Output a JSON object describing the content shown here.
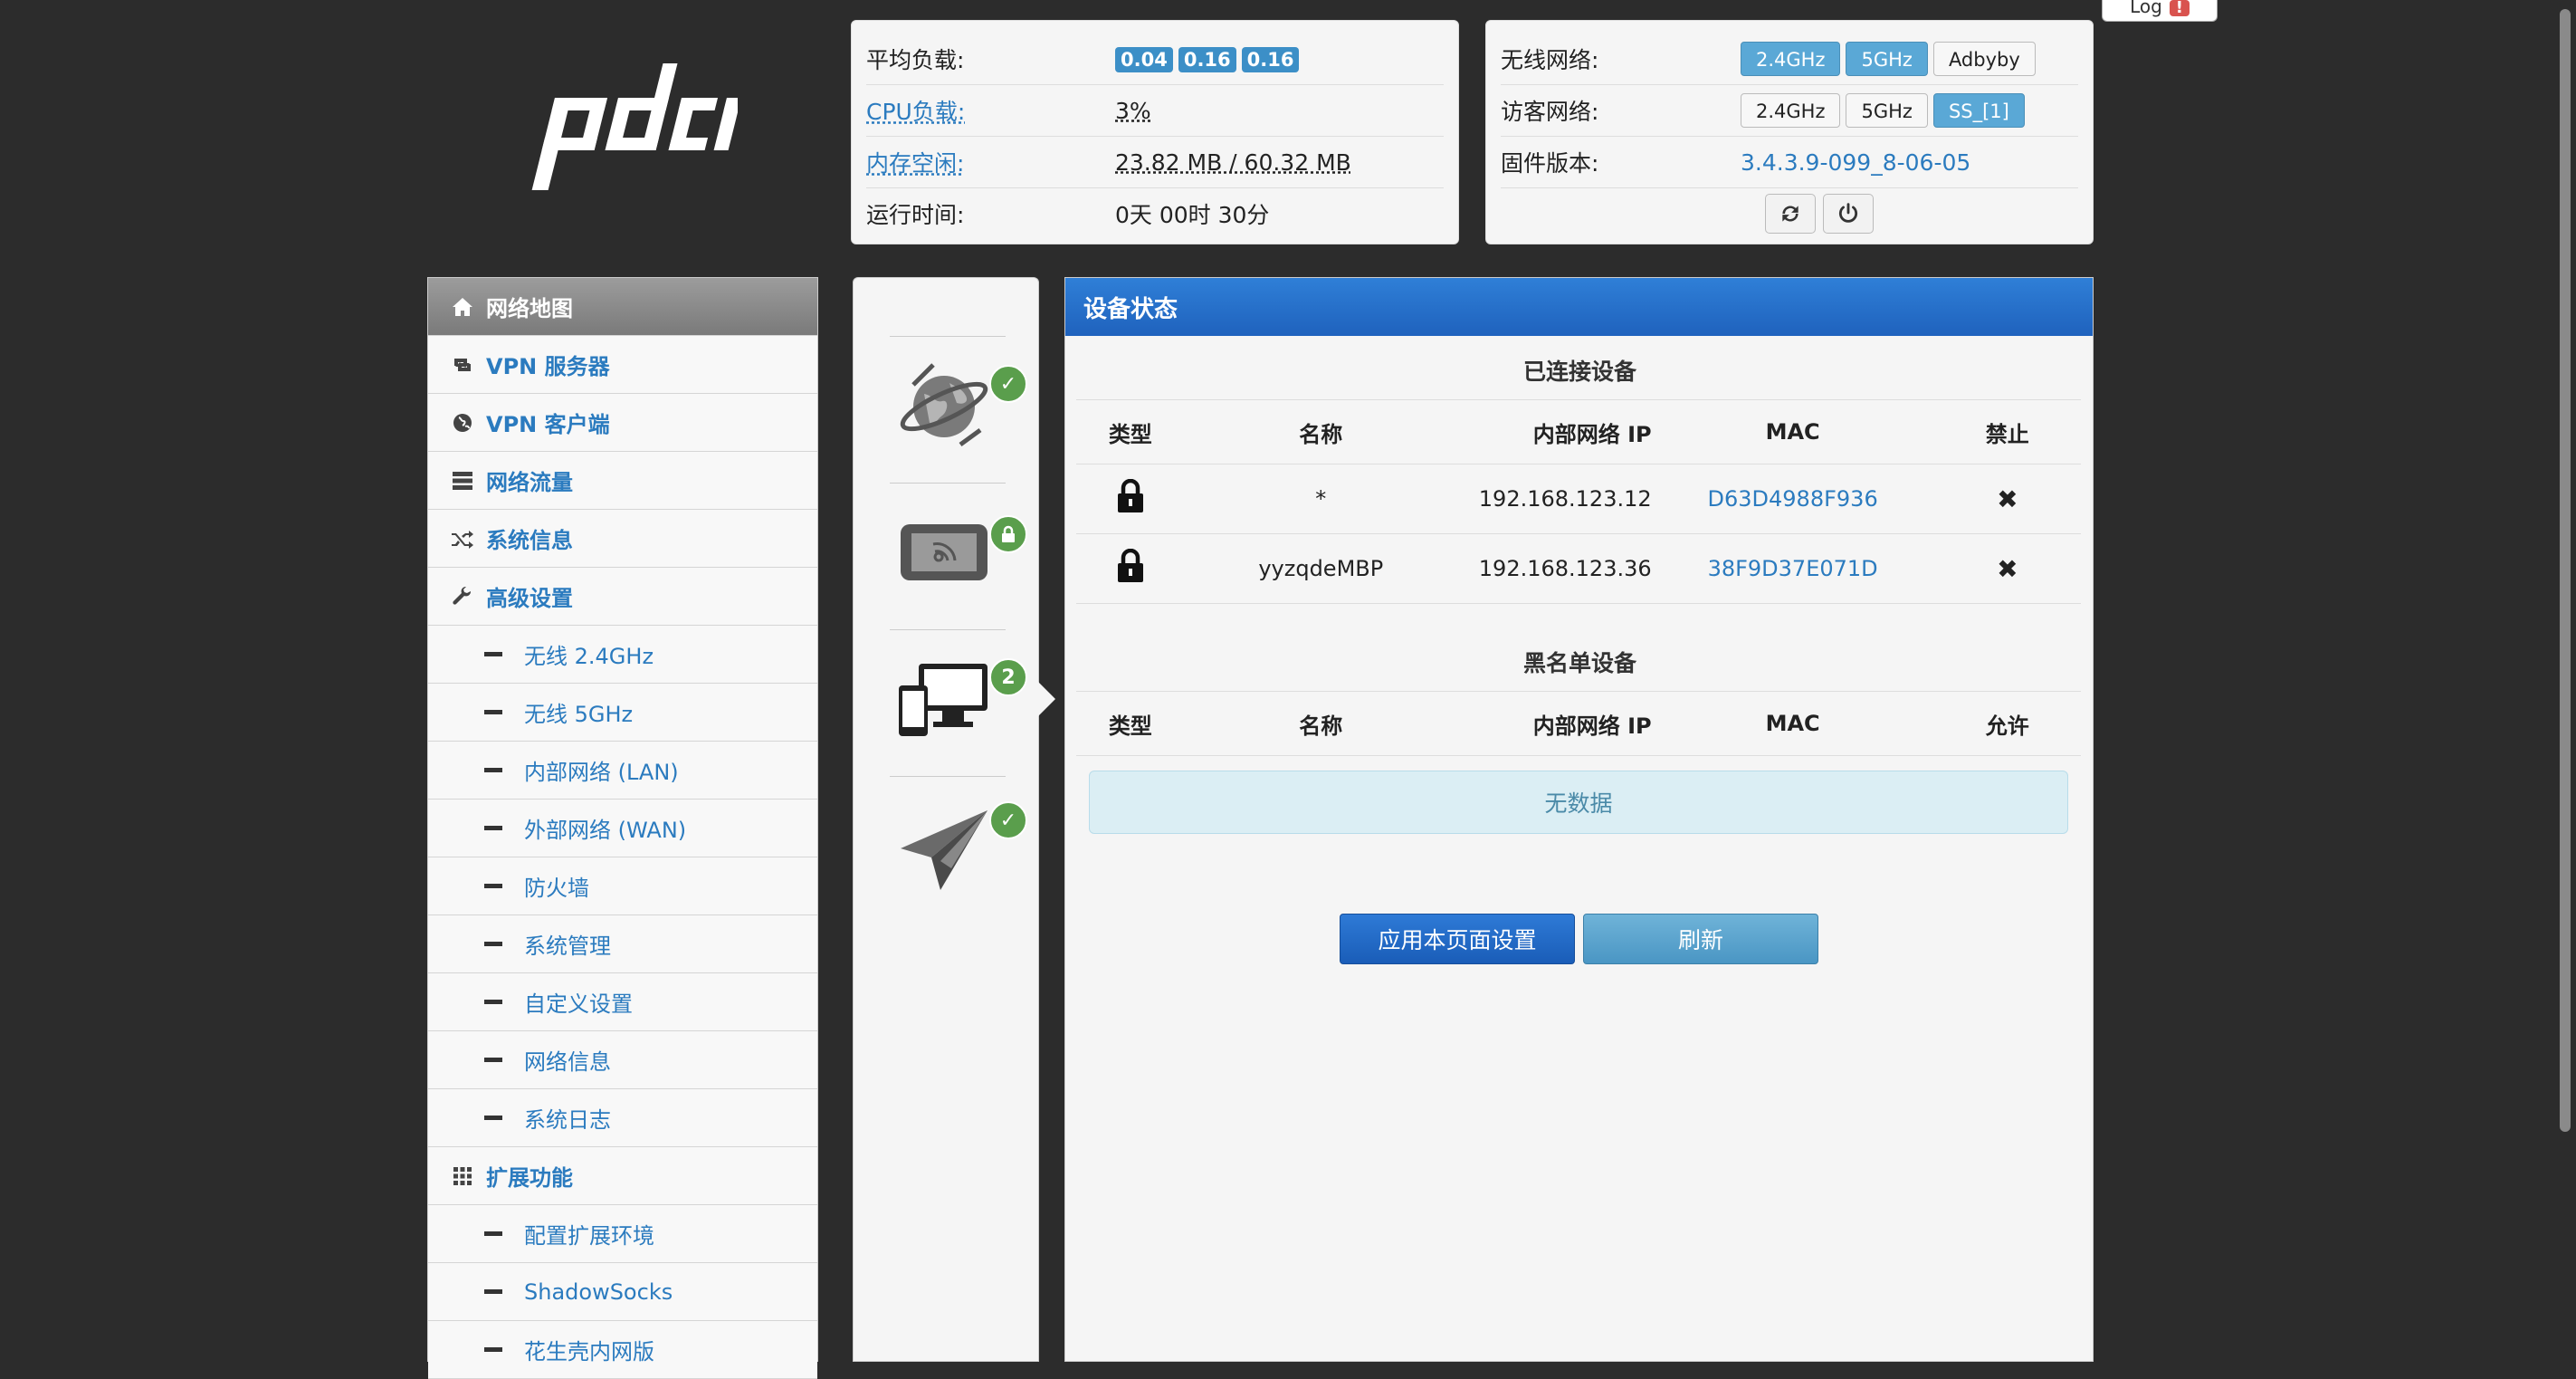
{
  "logo": {
    "text": "pdcn"
  },
  "log_tab": {
    "label": "Log",
    "badge": "!"
  },
  "system": {
    "avg_load_label": "平均负载:",
    "loads": [
      "0.04",
      "0.16",
      "0.16"
    ],
    "cpu_label": "CPU负载:",
    "cpu_value": "3%",
    "mem_label": "内存空闲:",
    "mem_value": "23.82 MB / 60.32 MB",
    "uptime_label": "运行时间:",
    "uptime_value": "0天 00时 30分"
  },
  "network": {
    "wireless_label": "无线网络:",
    "wireless_buttons": [
      "2.4GHz",
      "5GHz",
      "Adbyby"
    ],
    "guest_label": "访客网络:",
    "guest_buttons": [
      "2.4GHz",
      "5GHz",
      "SS_[1]"
    ],
    "firmware_label": "固件版本:",
    "firmware_value": "3.4.3.9-099_8-06-05"
  },
  "sidebar": {
    "items": [
      {
        "label": "网络地图",
        "icon": "home-icon"
      },
      {
        "label": "VPN 服务器",
        "icon": "retweet-icon"
      },
      {
        "label": "VPN 客户端",
        "icon": "globe-icon"
      },
      {
        "label": "网络流量",
        "icon": "server-icon"
      },
      {
        "label": "系统信息",
        "icon": "random-icon"
      },
      {
        "label": "高级设置",
        "icon": "wrench-icon"
      }
    ],
    "advanced_sub": [
      "无线 2.4GHz",
      "无线 5GHz",
      "内部网络 (LAN)",
      "外部网络 (WAN)",
      "防火墙",
      "系统管理",
      "自定义设置",
      "网络信息",
      "系统日志"
    ],
    "ext_label": "扩展功能",
    "ext_sub": [
      "配置扩展环境",
      "ShadowSocks",
      "花生壳内网版"
    ]
  },
  "status_icons": {
    "clients_count": "2"
  },
  "main": {
    "title": "设备状态",
    "connected_title": "已连接设备",
    "connected_headers": [
      "类型",
      "名称",
      "内部网络 IP",
      "MAC",
      "禁止"
    ],
    "connected_rows": [
      {
        "name": "*",
        "ip": "192.168.123.12",
        "mac": "D63D4988F936"
      },
      {
        "name": "yyzqdeMBP",
        "ip": "192.168.123.36",
        "mac": "38F9D37E071D"
      }
    ],
    "blacklist_title": "黑名单设备",
    "blacklist_headers": [
      "类型",
      "名称",
      "内部网络 IP",
      "MAC",
      "允许"
    ],
    "no_data": "无数据",
    "apply_label": "应用本页面设置",
    "refresh_label": "刷新"
  }
}
